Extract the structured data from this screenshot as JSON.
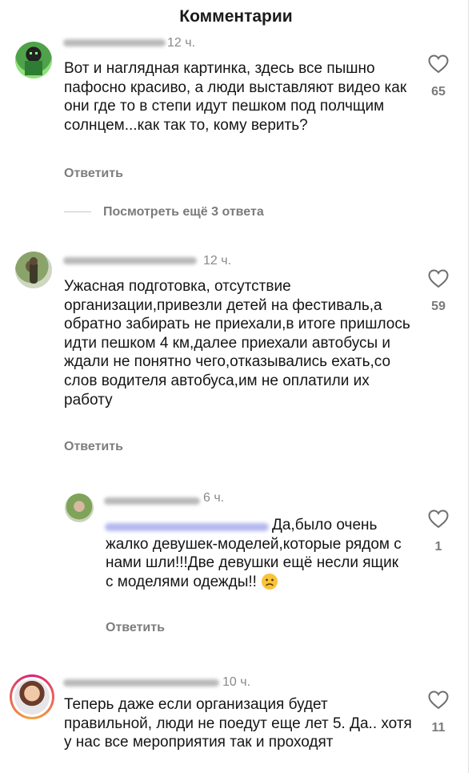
{
  "header": {
    "title": "Комментарии"
  },
  "comments": [
    {
      "time": "12 ч.",
      "text": "Вот и наглядная картинка, здесь все пышно пафосно красиво, а люди выставляют видео как они где то в степи идут пешком под полчщим солнцем...как так то, кому верить?",
      "reply_label": "Ответить",
      "likes": "65",
      "more_replies": "Посмотреть ещё 3 ответа"
    },
    {
      "time": "12 ч.",
      "text": "Ужасная подготовка, отсутствие организации,привезли детей на фестиваль,а обратно забирать не приехали,в итоге пришлось идти пешком 4 км,далее приехали автобусы и ждали не понятно чего,отказывались ехать,со слов водителя автобуса,им не оплатили их работу",
      "reply_label": "Ответить",
      "likes": "59"
    },
    {
      "time": "6 ч.",
      "text": "Да,было очень жалко девушек-моделей,которые рядом с нами шли!!!Две девушки ещё несли ящик с моделями одежды!!",
      "reply_label": "Ответить",
      "likes": "1",
      "is_reply": true
    },
    {
      "time": "10 ч.",
      "text": "Теперь даже если организация будет правильной, люди не поедут еще лет 5. Да.. хотя у нас все мероприятия так и проходят",
      "likes": "11"
    }
  ],
  "icons": {
    "like": "heart-outline-icon",
    "emoji": "worried-face-emoji"
  }
}
